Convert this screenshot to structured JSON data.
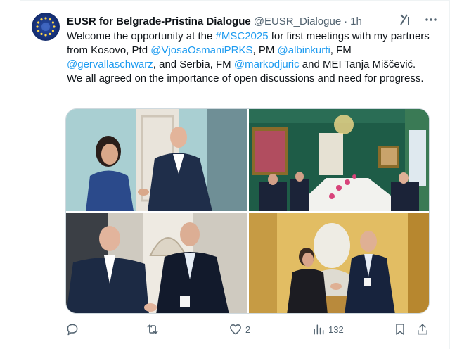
{
  "tweet": {
    "author_name": "EUSR for Belgrade-Pristina Dialogue",
    "handle": "@EUSR_Dialogue",
    "separator": "·",
    "time": "1h",
    "text_segments": [
      {
        "t": "Welcome the opportunity at the ",
        "link": false
      },
      {
        "t": "#MSC2025",
        "link": true
      },
      {
        "t": " for first meetings with my partners from Kosovo, Ptd ",
        "link": false
      },
      {
        "t": "@VjosaOsmaniPRKS",
        "link": true
      },
      {
        "t": ", PM ",
        "link": false
      },
      {
        "t": "@albinkurti",
        "link": true
      },
      {
        "t": ", FM ",
        "link": false
      },
      {
        "t": "@gervallaschwarz",
        "link": true
      },
      {
        "t": ", and Serbia, FM ",
        "link": false
      },
      {
        "t": "@markodjuric",
        "link": true
      },
      {
        "t": " and MEI Tanja Miščević. We all agreed on the importance of open discussions and need for progress.",
        "link": false
      }
    ],
    "photos": [
      {
        "name": "photo-handshake-osmani"
      },
      {
        "name": "photo-meeting-room-green"
      },
      {
        "name": "photo-handshake-djuric"
      },
      {
        "name": "photo-handshake-miscevic"
      }
    ]
  },
  "actions": {
    "reply_count": "",
    "retweet_count": "",
    "like_count": "2",
    "views_count": "132"
  },
  "colors": {
    "link": "#1d9bf0",
    "secondary_text": "#536471",
    "border": "#cfd9de"
  }
}
